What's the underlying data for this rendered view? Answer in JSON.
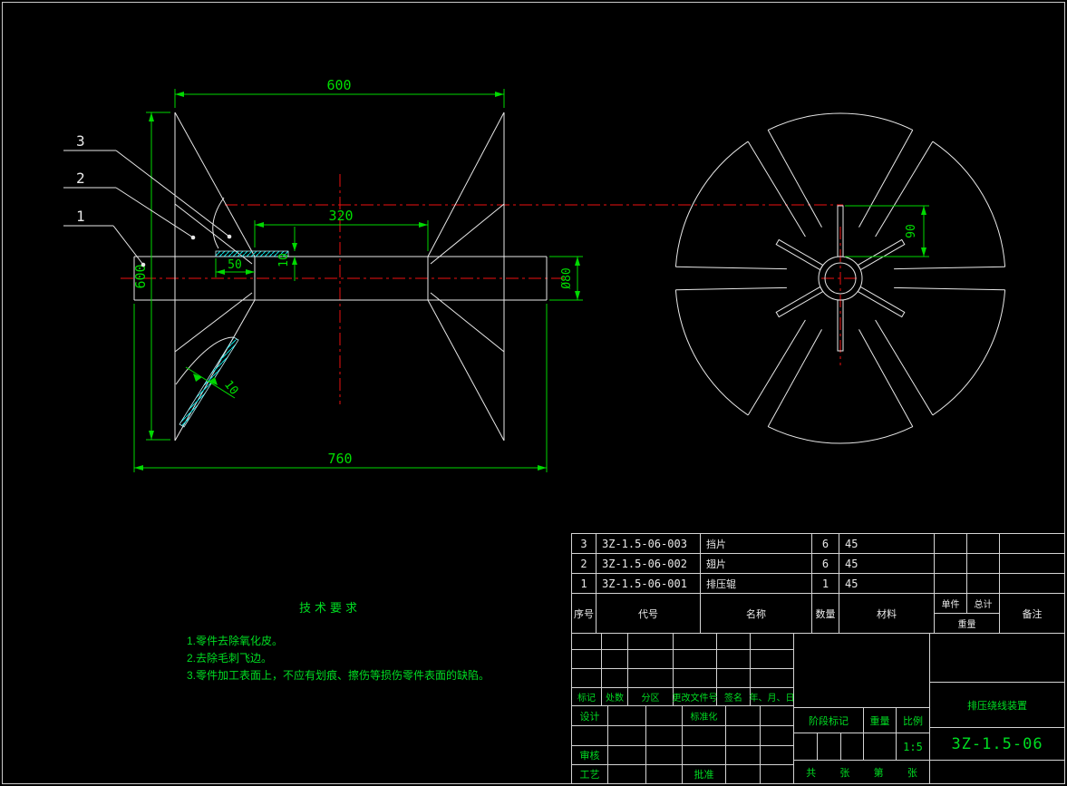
{
  "drawing": {
    "dimensions": {
      "top_width": "600",
      "flange_diameter": "600",
      "drum_length": "320",
      "fin_offset": "50",
      "fin_thickness_front": "10",
      "shaft_diameter": "Ø80",
      "overall_length": "760",
      "fin_slant_thickness": "10",
      "fin_height": "90"
    },
    "balloons": [
      {
        "label": "3"
      },
      {
        "label": "2"
      },
      {
        "label": "1"
      }
    ]
  },
  "tech_req": {
    "title": "技术要求",
    "items": [
      "1.零件去除氧化皮。",
      "2.去除毛刺飞边。",
      "3.零件加工表面上，不应有划痕、擦伤等损伤零件表面的缺陷。"
    ]
  },
  "bom": {
    "headers": {
      "seq": "序号",
      "code": "代号",
      "name": "名称",
      "qty": "数量",
      "material": "材料",
      "unit": "单件",
      "total": "总计",
      "weight": "重量",
      "remark": "备注"
    },
    "rows": [
      {
        "seq": "3",
        "code": "3Z-1.5-06-003",
        "name": "挡片",
        "qty": "6",
        "material": "45"
      },
      {
        "seq": "2",
        "code": "3Z-1.5-06-002",
        "name": "翅片",
        "qty": "6",
        "material": "45"
      },
      {
        "seq": "1",
        "code": "3Z-1.5-06-001",
        "name": "排压辊",
        "qty": "1",
        "material": "45"
      }
    ]
  },
  "titleblock": {
    "labels": {
      "mark": "标记",
      "count": "处数",
      "zone": "分区",
      "change_doc": "更改文件号",
      "sign": "签名",
      "date": "年、月、日",
      "design": "设计",
      "standardize": "标准化",
      "check": "审核",
      "process": "工艺",
      "approve": "批准",
      "stage_mark": "阶段标记",
      "weight": "重量",
      "scale": "比例",
      "pages_total": "共",
      "pages_unit": "张",
      "page_no": "第",
      "page_unit": "张"
    },
    "scale_value": "1:5",
    "title": "排压绕线装置",
    "drawing_no": "3Z-1.5-06"
  },
  "colors": {
    "geometry_white": "#e8e8e8",
    "dimension_green": "#00dd00",
    "centerline_red": "#ee1111",
    "hatch_cyan": "#00dcdc"
  }
}
